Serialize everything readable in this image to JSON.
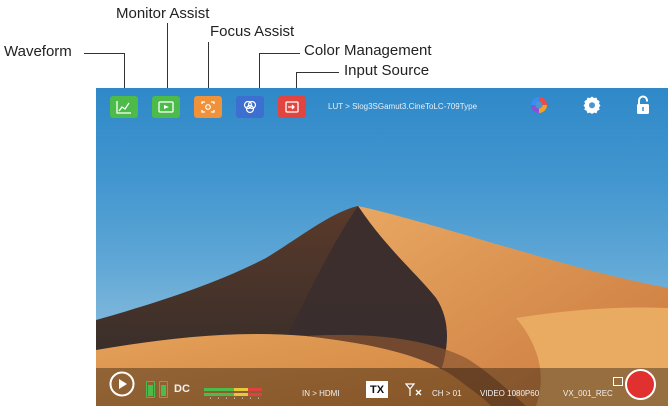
{
  "callouts": {
    "waveform": "Waveform",
    "monitor_assist": "Monitor Assist",
    "focus_assist": "Focus Assist",
    "color_management": "Color Management",
    "input_source": "Input Source"
  },
  "toolbar": {
    "buttons": [
      {
        "name": "waveform",
        "color": "#4cbb4a"
      },
      {
        "name": "monitor-assist",
        "color": "#4cbb4a"
      },
      {
        "name": "focus-assist",
        "color": "#f0923a"
      },
      {
        "name": "color-management",
        "color": "#3d6fd1"
      },
      {
        "name": "input-source",
        "color": "#e2453f"
      }
    ],
    "lut_text": "LUT > Slog3SGamut3.CineToLC-709Type",
    "icons": [
      "color-wheel-icon",
      "settings-icon",
      "lock-icon"
    ]
  },
  "status_bar": {
    "power": "DC",
    "input": "IN > HDMI",
    "tx_badge": "TX",
    "channel": "CH > 01",
    "video_format": "VIDEO 1080P60",
    "record_name": "VX_001_REC",
    "record_color": "#e03030"
  }
}
